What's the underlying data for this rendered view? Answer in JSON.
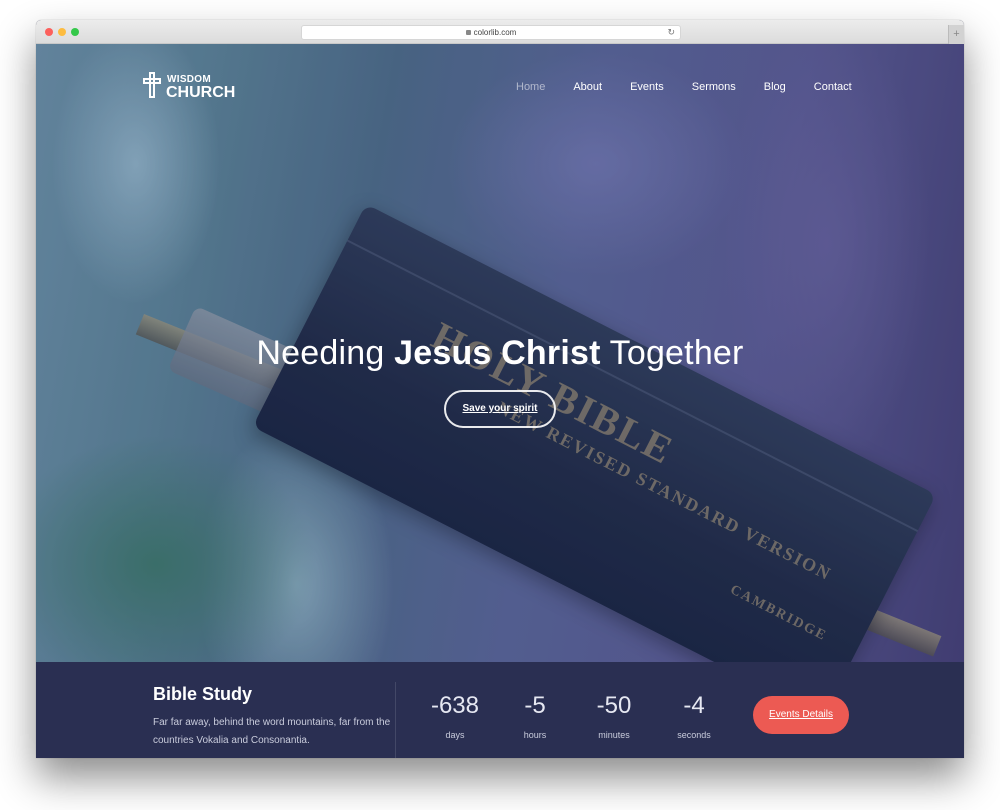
{
  "browser": {
    "url": "colorlib.com",
    "new_tab_label": "+"
  },
  "site": {
    "logo": {
      "top": "WISDOM",
      "bottom": "CHURCH",
      "icon": "cross-icon"
    },
    "nav": [
      {
        "label": "Home",
        "active": true
      },
      {
        "label": "About",
        "active": false
      },
      {
        "label": "Events",
        "active": false
      },
      {
        "label": "Sermons",
        "active": false
      },
      {
        "label": "Blog",
        "active": false
      },
      {
        "label": "Contact",
        "active": false
      }
    ]
  },
  "hero": {
    "headline_pre": "Needing ",
    "headline_bold": "Jesus Christ",
    "headline_post": " Together",
    "cta_label": "Save your spirit",
    "background_book_text": [
      "HOLY BIBLE",
      "NEW REVISED STANDARD VERSION",
      "CAMBRIDGE"
    ]
  },
  "event": {
    "title": "Bible Study",
    "description": "Far far away, behind the word mountains, far from the countries Vokalia and Consonantia.",
    "countdown": [
      {
        "value": "-638",
        "unit": "days"
      },
      {
        "value": "-5",
        "unit": "hours"
      },
      {
        "value": "-50",
        "unit": "minutes"
      },
      {
        "value": "-4",
        "unit": "seconds"
      }
    ],
    "button_label": "Events Details",
    "button_color": "#ec5a53",
    "bar_color": "#2a2f52"
  }
}
